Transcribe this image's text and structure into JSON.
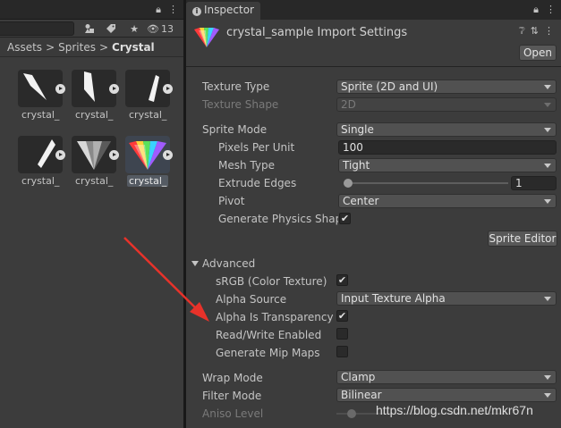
{
  "project": {
    "search_placeholder": "",
    "hidden_count": "13",
    "breadcrumb": [
      "Assets",
      "Sprites",
      "Crystal"
    ],
    "assets": [
      {
        "label": "crystal_",
        "selected": false
      },
      {
        "label": "crystal_",
        "selected": false
      },
      {
        "label": "crystal_",
        "selected": false
      },
      {
        "label": "crystal_",
        "selected": false
      },
      {
        "label": "crystal_",
        "selected": false
      },
      {
        "label": "crystal_",
        "selected": true
      }
    ]
  },
  "inspector": {
    "tab_label": "Inspector",
    "title": "crystal_sample Import Settings",
    "open_label": "Open",
    "fields": {
      "texture_type": {
        "label": "Texture Type",
        "value": "Sprite (2D and UI)"
      },
      "texture_shape": {
        "label": "Texture Shape",
        "value": "2D"
      },
      "sprite_mode": {
        "label": "Sprite Mode",
        "value": "Single"
      },
      "pixels_per_unit": {
        "label": "Pixels Per Unit",
        "value": "100"
      },
      "mesh_type": {
        "label": "Mesh Type",
        "value": "Tight"
      },
      "extrude_edges": {
        "label": "Extrude Edges",
        "value": "1",
        "level": 0.0
      },
      "pivot": {
        "label": "Pivot",
        "value": "Center"
      },
      "generate_physics_shape": {
        "label": "Generate Physics Shape",
        "checked": true
      },
      "sprite_editor_label": "Sprite Editor",
      "advanced_label": "Advanced",
      "srgb": {
        "label": "sRGB (Color Texture)",
        "checked": true
      },
      "alpha_source": {
        "label": "Alpha Source",
        "value": "Input Texture Alpha"
      },
      "alpha_is_transparency": {
        "label": "Alpha Is Transparency",
        "checked": true
      },
      "read_write_enabled": {
        "label": "Read/Write Enabled",
        "checked": false
      },
      "generate_mip_maps": {
        "label": "Generate Mip Maps",
        "checked": false
      },
      "wrap_mode": {
        "label": "Wrap Mode",
        "value": "Clamp"
      },
      "filter_mode": {
        "label": "Filter Mode",
        "value": "Bilinear"
      },
      "aniso_level": {
        "label": "Aniso Level",
        "level": 0.0
      }
    }
  },
  "watermark": "https://blog.csdn.net/mkr67n",
  "colors": {
    "panel_bg": "#3c3c3c",
    "tab_bar_bg": "#282828",
    "annotation_arrow": "#e8322a"
  }
}
